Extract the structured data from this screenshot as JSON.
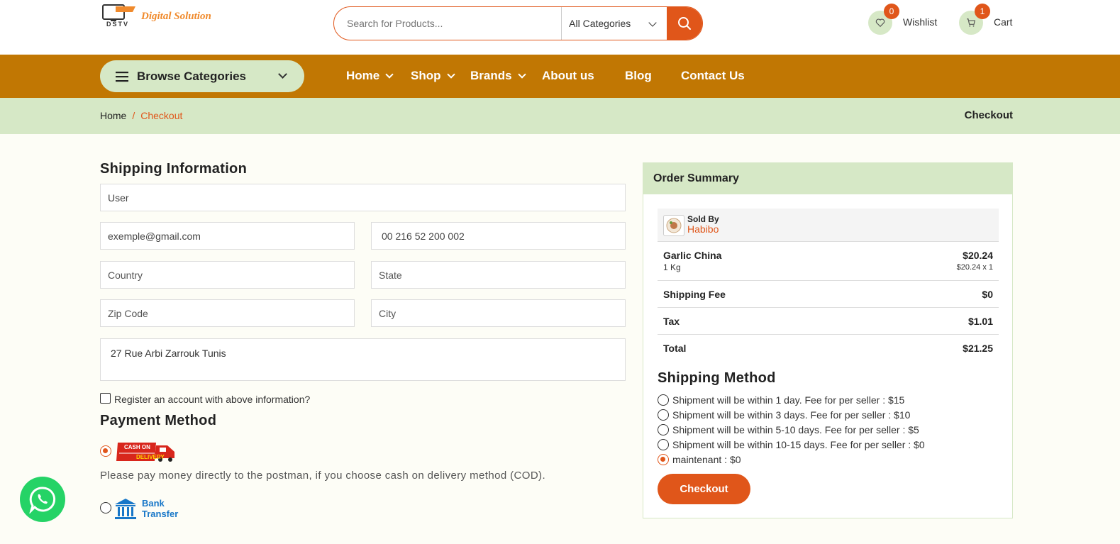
{
  "header": {
    "brand": "Digital Solution",
    "brand_mark": "DSTV",
    "search_placeholder": "Search for Products...",
    "category_select": "All Categories",
    "wishlist": {
      "label": "Wishlist",
      "count": "0"
    },
    "cart": {
      "label": "Cart",
      "count": "1"
    }
  },
  "nav": {
    "browse_label": "Browse Categories",
    "items": [
      {
        "label": "Home"
      },
      {
        "label": "Shop"
      },
      {
        "label": "Brands"
      },
      {
        "label": "About us"
      },
      {
        "label": "Blog"
      },
      {
        "label": "Contact Us"
      }
    ]
  },
  "breadcrumb": {
    "home": "Home",
    "separator": "/",
    "current": "Checkout",
    "title": "Checkout"
  },
  "shipping_form": {
    "title": "Shipping Information",
    "name": "User",
    "email": "exemple@gmail.com",
    "phone": "00 216 52 200 002",
    "country_placeholder": "Country",
    "state_placeholder": "State",
    "zip_placeholder": "Zip Code",
    "city_placeholder": "City",
    "address": "27 Rue Arbi Zarrouk Tunis",
    "register_label": "Register an account with above information?"
  },
  "payment": {
    "title": "Payment Method",
    "cod_logo_text": [
      "CASH ON",
      "DELIVERY"
    ],
    "cod_note": "Please pay money directly to the postman, if you choose cash on delivery method (COD).",
    "bank_logo_text": [
      "Bank",
      "Transfer"
    ]
  },
  "order_summary": {
    "title": "Order Summary",
    "sold_by_label": "Sold By",
    "seller": "Habibo",
    "item": {
      "name": "Garlic China",
      "variant": "1 Kg",
      "price": "$20.24",
      "unit_line": "$20.24 x 1"
    },
    "shipping_fee": {
      "label": "Shipping Fee",
      "value": "$0"
    },
    "tax": {
      "label": "Tax",
      "value": "$1.01"
    },
    "total": {
      "label": "Total",
      "value": "$21.25"
    }
  },
  "shipping_method": {
    "title": "Shipping Method",
    "options": [
      {
        "label": "Shipment will be within 1 day. Fee for per seller : $15",
        "selected": false
      },
      {
        "label": "Shipment will be within 3 days. Fee for per seller : $10",
        "selected": false
      },
      {
        "label": "Shipment will be within 5-10 days. Fee for per seller : $5",
        "selected": false
      },
      {
        "label": "Shipment will be within 10-15 days. Fee for per seller : $0",
        "selected": false
      },
      {
        "label": "maintenant : $0",
        "selected": true
      }
    ],
    "checkout_label": "Checkout"
  },
  "colors": {
    "accent": "#e0561a",
    "nav_bg": "#c17703",
    "light_green": "#d6e8c6",
    "whatsapp": "#25d366"
  }
}
